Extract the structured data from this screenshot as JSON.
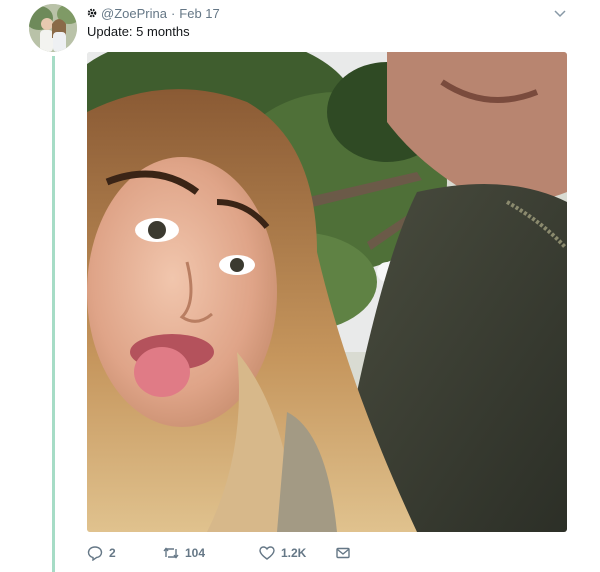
{
  "tweet": {
    "handle": "@ZoePrina",
    "separator": "·",
    "date": "Feb 17",
    "text": "Update: 5 months"
  },
  "actions": {
    "replies": "2",
    "retweets": "104",
    "likes": "1.2K"
  },
  "icons": {
    "header_badge": "gear-icon",
    "menu": "chevron-down-icon",
    "reply": "reply-icon",
    "retweet": "retweet-icon",
    "like": "heart-icon",
    "dm": "envelope-icon"
  },
  "colors": {
    "thread_line": "#a6dcc6",
    "secondary_text": "#657786",
    "primary_text": "#14171a"
  }
}
